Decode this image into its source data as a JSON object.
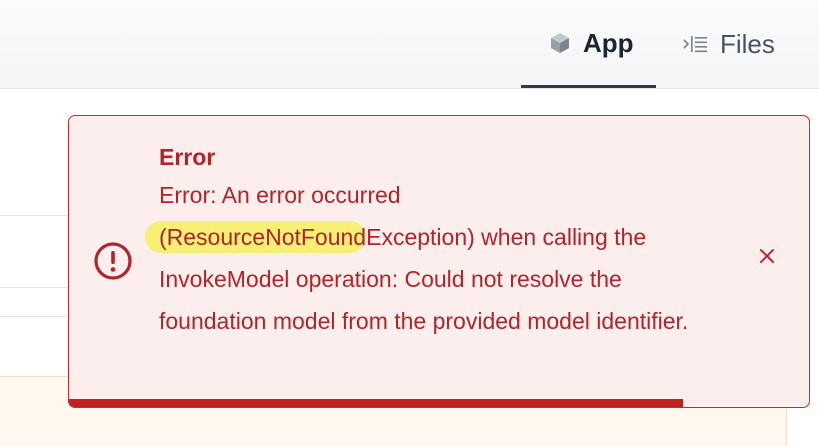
{
  "tabs": [
    {
      "label": "App",
      "icon": "cube-icon",
      "active": true
    },
    {
      "label": "Files",
      "icon": "file-tree-icon",
      "active": false
    }
  ],
  "toast": {
    "title": "Error",
    "message_before": "Error: An error occurred ",
    "message_highlight": "(ResourceNotFound",
    "message_after": "Exception) when calling the InvokeModel operation: Could not resolve the foundation model from the provided model identifier.",
    "icon": "error-circle-icon",
    "close_icon": "close-icon",
    "close_glyph": "×",
    "progress_fraction": 0.83,
    "colors": {
      "text": "#b0242a",
      "background": "#fdeeee",
      "border": "#c8292f",
      "highlight": "#f8f074"
    }
  }
}
